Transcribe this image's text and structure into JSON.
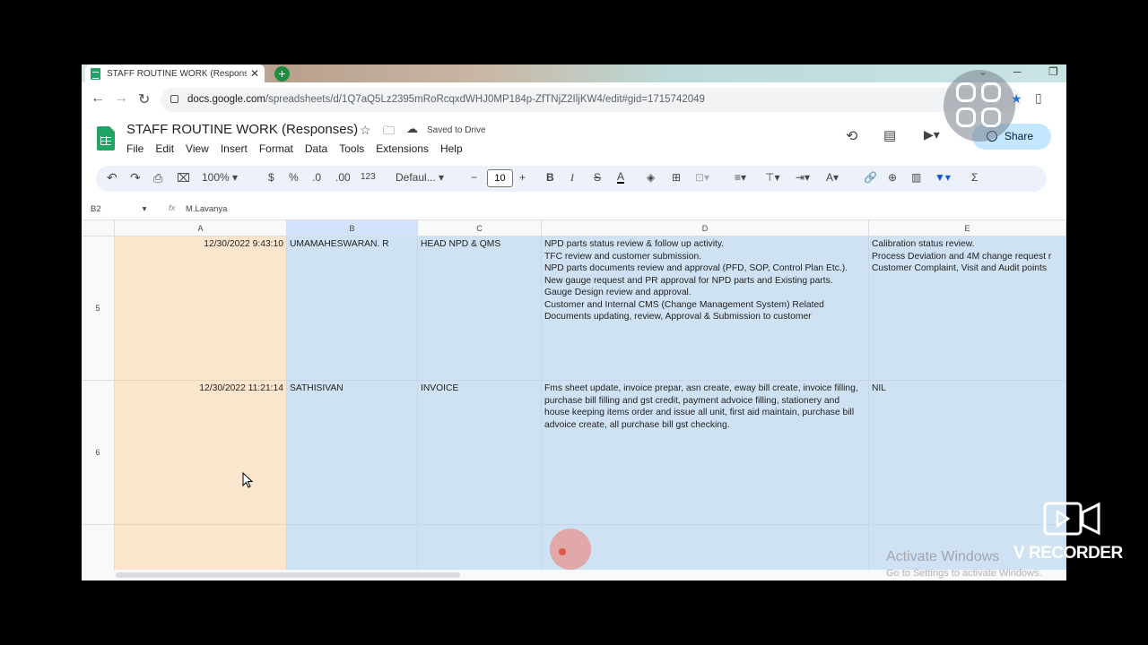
{
  "browser": {
    "tab_title": "STAFF ROUTINE WORK (Respons",
    "url_host": "docs.google.com",
    "url_path": "/spreadsheets/d/1Q7aQ5Lz2395mRoRcqxdWHJ0MP184p-ZfTNjZ2IljKW4/edit#gid=1715742049"
  },
  "doc": {
    "title": "STAFF ROUTINE WORK (Responses)",
    "saved_status": "Saved to Drive",
    "share_label": "Share",
    "menu": [
      "File",
      "Edit",
      "View",
      "Insert",
      "Format",
      "Data",
      "Tools",
      "Extensions",
      "Help"
    ]
  },
  "toolbar": {
    "zoom": "100%",
    "currency": "$",
    "percent": "%",
    "dec_decrease": ".0",
    "dec_increase": ".00",
    "number_format": "123",
    "font": "Defaul...",
    "font_size": "10",
    "bold": "B",
    "italic": "I",
    "strike": "S",
    "text_color": "A"
  },
  "formula_bar": {
    "cell_ref": "B2",
    "fx": "fx",
    "value": "M.Lavanya"
  },
  "sheet": {
    "columns": [
      "A",
      "B",
      "C",
      "D",
      "E"
    ],
    "rows": [
      {
        "number": "5",
        "a": "12/30/2022 9:43:10",
        "b": "UMAMAHESWARAN. R",
        "c": "HEAD NPD & QMS",
        "d": "NPD parts status review & follow up activity.\nTFC review and customer submission.\nNPD parts documents review and approval (PFD, SOP, Control Plan Etc.).\nNew gauge request and PR approval for NPD parts and Existing parts.\nGauge Design review and approval.\nCustomer and Internal CMS (Change Management System) Related Documents updating, review, Approval & Submission to customer",
        "e": "Calibration status review.\nProcess Deviation and 4M change request r\nCustomer Complaint, Visit and Audit points"
      },
      {
        "number": "6",
        "a": "12/30/2022 11:21:14",
        "b": "SATHISIVAN",
        "c": "INVOICE",
        "d": "Fms sheet update, invoice prepar, asn create, eway bill create, invoice filling, purchase bill filling and gst credit, payment advoice filling, stationery and house keeping items order and issue all unit, first aid maintain, purchase bill advoice create, all purchase bill gst checking.",
        "e": "NIL"
      },
      {
        "number": "",
        "a": "",
        "b": "",
        "c": "",
        "d": "",
        "e": ""
      }
    ]
  },
  "overlays": {
    "activate_title": "Activate Windows",
    "activate_sub": "Go to Settings to activate Windows.",
    "recorder_label": "V RECORDER"
  },
  "colors": {
    "col_a_fill": "#fce5cd",
    "col_b_fill": "#cfe2f3",
    "share_bg": "#c2e7ff",
    "sheets_green": "#1fa463"
  }
}
